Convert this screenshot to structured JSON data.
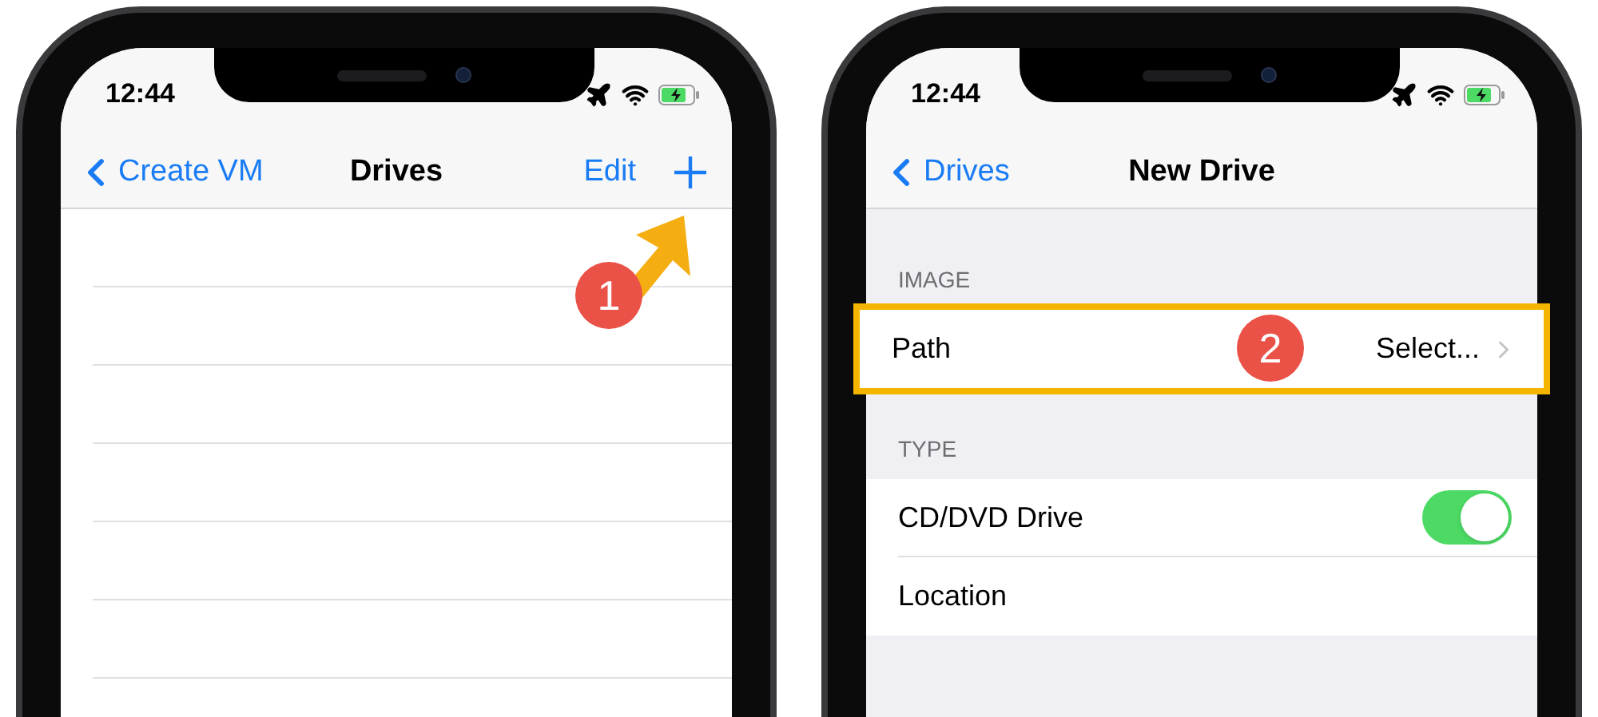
{
  "left_screen": {
    "status_time": "12:44",
    "nav": {
      "back": "Create VM",
      "title": "Drives",
      "edit": "Edit",
      "add_marker": "1"
    }
  },
  "right_screen": {
    "status_time": "12:44",
    "nav": {
      "back": "Drives",
      "title": "New Drive"
    },
    "sections": [
      {
        "header": "IMAGE",
        "rows": [
          {
            "kind": "disclosure",
            "label": "Path",
            "value": "Select...",
            "highlighted": true,
            "marker": "2"
          }
        ]
      },
      {
        "header": "TYPE",
        "rows": [
          {
            "kind": "switch",
            "label": "CD/DVD Drive",
            "on": true
          },
          {
            "kind": "plain",
            "label": "Location"
          }
        ]
      }
    ]
  }
}
